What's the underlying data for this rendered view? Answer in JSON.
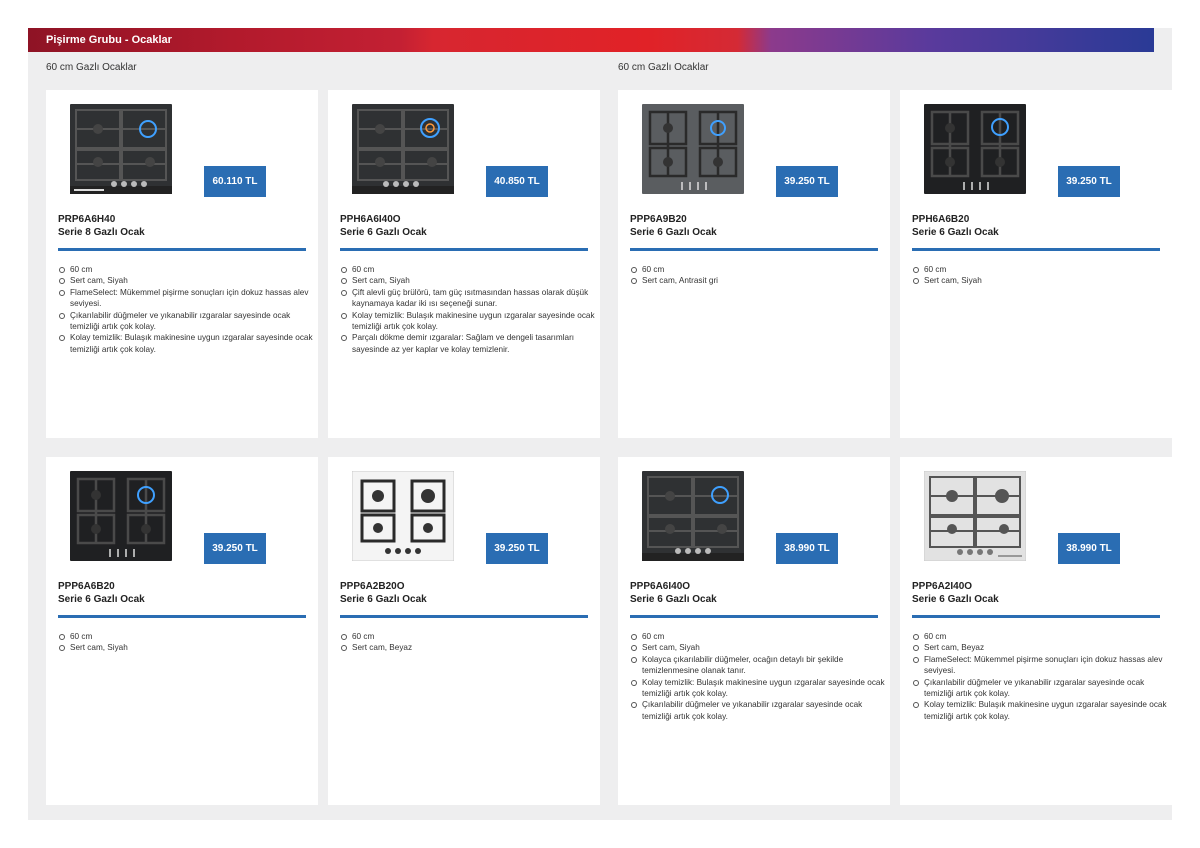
{
  "header": {
    "title": "Pişirme Grubu - Ocaklar"
  },
  "sections": [
    {
      "title": "60 cm Gazlı Ocaklar"
    },
    {
      "title": "60 cm Gazlı Ocaklar"
    }
  ],
  "products": [
    {
      "model": "PRP6A6H40",
      "series": "Serie 8 Gazlı Ocak",
      "price": "60.110 TL",
      "features": [
        "60 cm",
        "Sert cam, Siyah",
        "FlameSelect: Mükemmel pişirme sonuçları için dokuz hassas alev seviyesi.",
        "Çıkarılabilir düğmeler ve yıkanabilir ızgaralar sayesinde ocak temizliği artık çok kolay.",
        "Kolay temizlik: Bulaşık makinesine uygun ızgaralar sayesinde ocak temizliği artık çok kolay."
      ]
    },
    {
      "model": "PPH6A6I40O",
      "series": "Serie 6 Gazlı Ocak",
      "price": "40.850 TL",
      "features": [
        "60 cm",
        "Sert cam, Siyah",
        "Çift alevli güç brülörü, tam güç ısıtmasından hassas olarak düşük kaynamaya kadar iki ısı seçeneği sunar.",
        "Kolay temizlik: Bulaşık makinesine uygun ızgaralar sayesinde ocak temizliği artık çok kolay.",
        "Parçalı dökme demir ızgaralar: Sağlam ve dengeli tasarımları sayesinde az yer kaplar ve kolay temizlenir."
      ]
    },
    {
      "model": "PPP6A9B20",
      "series": "Serie 6 Gazlı Ocak",
      "price": "39.250 TL",
      "features": [
        "60 cm",
        "Sert cam, Antrasit gri"
      ]
    },
    {
      "model": "PPH6A6B20",
      "series": "Serie 6 Gazlı Ocak",
      "price": "39.250 TL",
      "features": [
        "60 cm",
        "Sert cam, Siyah"
      ]
    },
    {
      "model": "PPP6A6B20",
      "series": "Serie 6 Gazlı Ocak",
      "price": "39.250 TL",
      "features": [
        "60 cm",
        "Sert cam, Siyah"
      ]
    },
    {
      "model": "PPP6A2B20O",
      "series": "Serie 6 Gazlı Ocak",
      "price": "39.250 TL",
      "features": [
        "60 cm",
        "Sert cam, Beyaz"
      ]
    },
    {
      "model": "PPP6A6I40O",
      "series": "Serie 6 Gazlı Ocak",
      "price": "38.990 TL",
      "features": [
        "60 cm",
        "Sert cam, Siyah",
        "Kolayca çıkarılabilir düğmeler, ocağın detaylı bir şekilde temizlenmesine olanak tanır.",
        "Kolay temizlik: Bulaşık makinesine uygun ızgaralar sayesinde ocak temizliği artık çok kolay.",
        "Çıkarılabilir düğmeler ve yıkanabilir ızgaralar sayesinde ocak temizliği artık çok kolay."
      ]
    },
    {
      "model": "PPP6A2I40O",
      "series": "Serie 6 Gazlı Ocak",
      "price": "38.990 TL",
      "features": [
        "60 cm",
        "Sert cam, Beyaz",
        "FlameSelect: Mükemmel pişirme sonuçları için dokuz hassas alev seviyesi.",
        "Çıkarılabilir düğmeler ve yıkanabilir ızgaralar sayesinde ocak temizliği artık çok kolay.",
        "Kolay temizlik: Bulaşık makinesine uygun ızgaralar sayesinde ocak temizliği artık çok kolay."
      ]
    }
  ],
  "colors": {
    "price_badge": "#2a6db3",
    "divider": "#2a6db3",
    "banner_start": "#8e1325",
    "banner_end": "#2a3a96"
  }
}
